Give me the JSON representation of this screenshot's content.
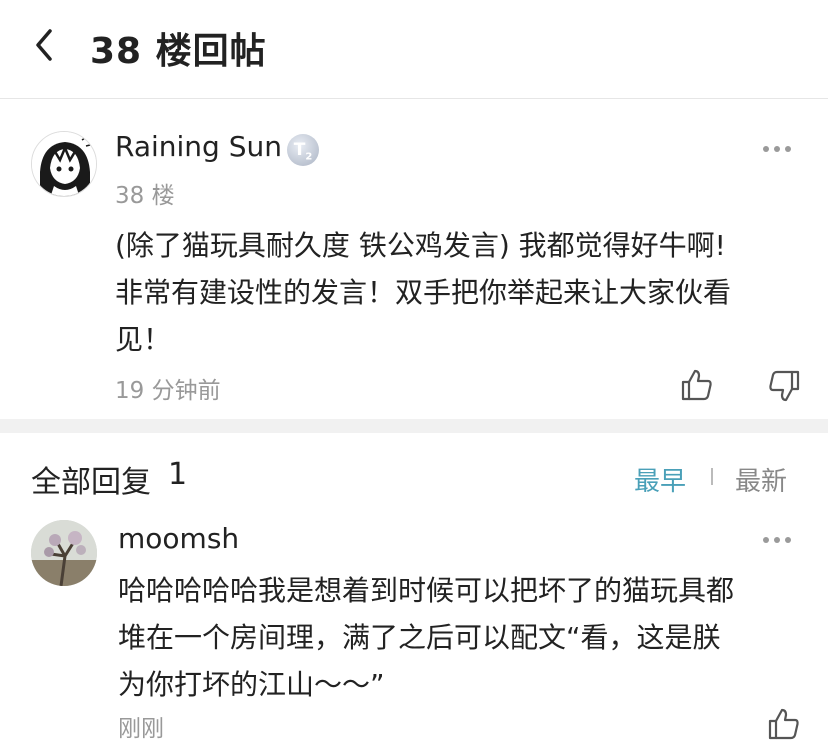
{
  "header": {
    "title": "38 楼回帖"
  },
  "post": {
    "username": "Raining Sun",
    "badge": "T",
    "badge_sub": "2",
    "floor": "38 楼",
    "lines": [
      "(除了猫玩具耐久度 铁公鸡发言) 我都觉得好牛啊!",
      "非常有建设性的发言！双手把你举起来让大家伙看",
      "见！"
    ],
    "time": "19 分钟前"
  },
  "replies_section": {
    "title": "全部回复",
    "count": "1",
    "sort_earliest": "最早",
    "sort_latest": "最新",
    "colors": {
      "active": "#4aa0b8",
      "inactive": "#888888"
    }
  },
  "reply": {
    "username": "moomsh",
    "lines": [
      "哈哈哈哈哈我是想着到时候可以把坏了的猫玩具都",
      "堆在一个房间理，满了之后可以配文“看，这是朕",
      "为你打坏的江山～～”"
    ],
    "time": "刚刚"
  }
}
